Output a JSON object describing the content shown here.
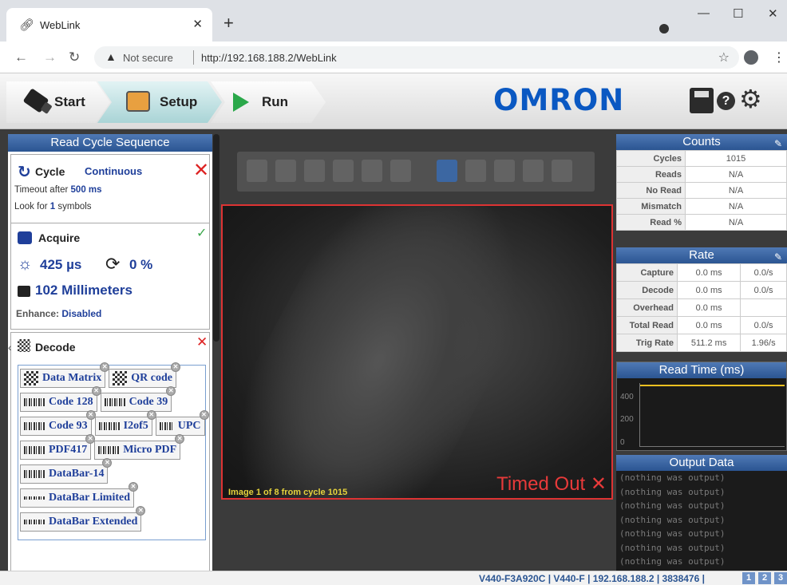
{
  "browser": {
    "tab_title": "WebLink",
    "url_security": "Not secure",
    "url": "http://192.168.188.2/WebLink"
  },
  "toolbar": {
    "start_label": "Start",
    "setup_label": "Setup",
    "run_label": "Run",
    "brand": "OMRON"
  },
  "sequence": {
    "title": "Read Cycle Sequence",
    "cycle": {
      "label": "Cycle",
      "mode": "Continuous",
      "timeout_prefix": "Timeout after",
      "timeout_value": "500 ms",
      "look_prefix": "Look for",
      "look_value": "1",
      "look_suffix": "symbols"
    },
    "acquire": {
      "label": "Acquire",
      "exposure": "425 µs",
      "gain": "0 %",
      "distance": "102 Millimeters",
      "enhance_label": "Enhance:",
      "enhance_value": "Disabled"
    },
    "decode": {
      "label": "Decode",
      "symbologies": [
        [
          "Data Matrix",
          "QR code"
        ],
        [
          "Code 128",
          "Code 39"
        ],
        [
          "Code 93",
          "I2of5",
          "UPC"
        ],
        [
          "PDF417",
          "Micro PDF"
        ],
        [
          "DataBar-14"
        ],
        [
          "DataBar Limited"
        ],
        [
          "DataBar Extended"
        ]
      ]
    }
  },
  "viewer": {
    "caption": "Image 1 of 8 from cycle 1015",
    "status": "Timed Out"
  },
  "counts": {
    "title": "Counts",
    "rows": [
      {
        "label": "Cycles",
        "value": "1015"
      },
      {
        "label": "Reads",
        "value": "N/A"
      },
      {
        "label": "No Read",
        "value": "N/A"
      },
      {
        "label": "Mismatch",
        "value": "N/A"
      },
      {
        "label": "Read %",
        "value": "N/A"
      }
    ]
  },
  "rate": {
    "title": "Rate",
    "rows": [
      {
        "label": "Capture",
        "time": "0.0 ms",
        "rate": "0.0/s"
      },
      {
        "label": "Decode",
        "time": "0.0 ms",
        "rate": "0.0/s"
      },
      {
        "label": "Overhead",
        "time": "0.0 ms",
        "rate": ""
      },
      {
        "label": "Total Read",
        "time": "0.0 ms",
        "rate": "0.0/s"
      },
      {
        "label": "Trig Rate",
        "time": "511.2 ms",
        "rate": "1.96/s"
      }
    ]
  },
  "read_time": {
    "title": "Read Time (ms)",
    "yticks": [
      "400",
      "200",
      "0"
    ],
    "ylim": [
      0,
      420
    ],
    "level": 410
  },
  "output": {
    "title": "Output Data",
    "lines": [
      "(nothing was output)",
      "(nothing was output)",
      "(nothing was output)",
      "(nothing was output)",
      "(nothing was output)",
      "(nothing was output)",
      "(nothing was output)",
      "(nothing was output)"
    ]
  },
  "status": {
    "text": "V440-F3A920C | V440-F | 192.168.188.2 | 3838476 |",
    "pages": [
      "1",
      "2",
      "3"
    ]
  }
}
